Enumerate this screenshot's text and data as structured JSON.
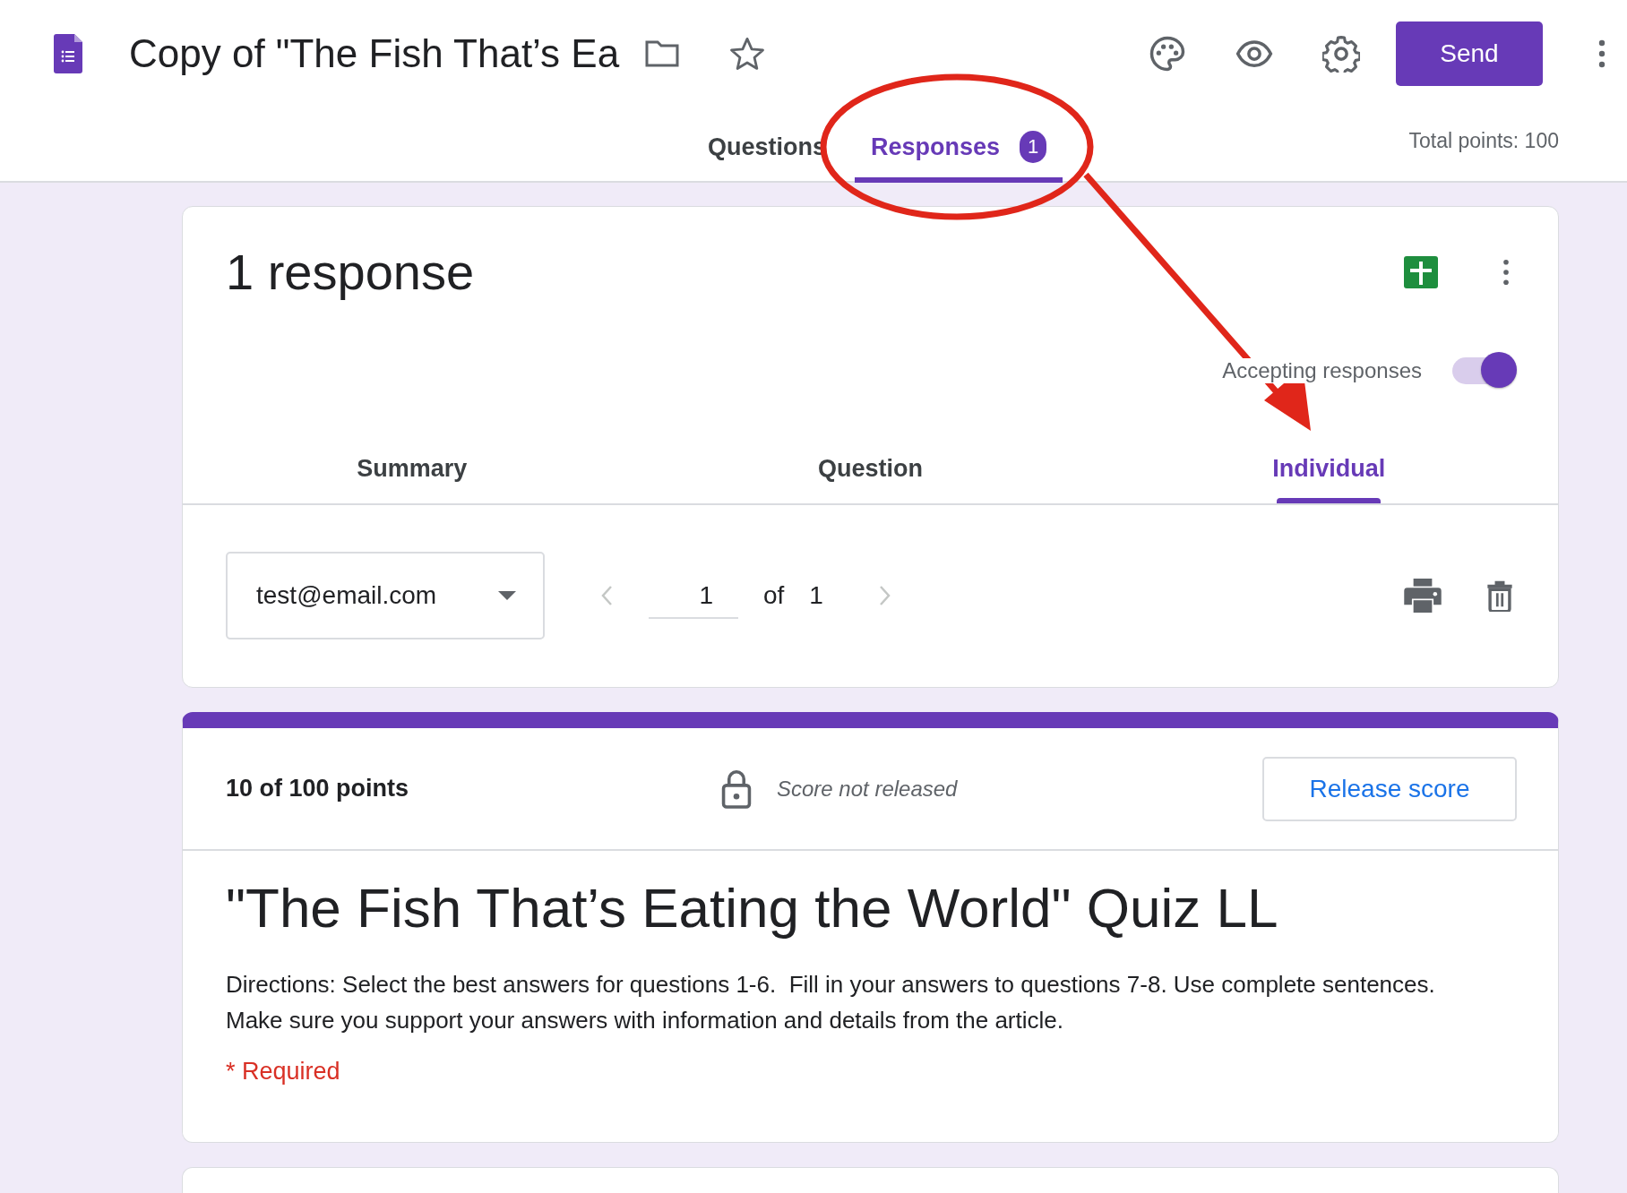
{
  "header": {
    "title": "Copy of \"The Fish That’s Ea",
    "send_label": "Send"
  },
  "tabs": [
    {
      "label": "Questions",
      "selected": false
    },
    {
      "label": "Responses",
      "selected": true,
      "badge": "1"
    }
  ],
  "total_points": "Total points: 100",
  "responses_card": {
    "title": "1 response",
    "accepting_label": "Accepting responses",
    "accepting_on": true,
    "views": [
      {
        "label": "Summary",
        "selected": false
      },
      {
        "label": "Question",
        "selected": false
      },
      {
        "label": "Individual",
        "selected": true
      }
    ],
    "respondent": "test@email.com",
    "page": "1",
    "of_label": "of",
    "page_total": "1"
  },
  "score_card": {
    "points": "10 of 100 points",
    "release_status": "Score not released",
    "release_button": "Release score",
    "quiz_title": "\"The Fish That’s Eating the World\" Quiz LL",
    "directions": "Directions: Select the best answers for questions 1-6.  Fill in your answers to questions 7-8. Use complete sentences. Make sure you support your answers with information and details from the article.",
    "required_note": "* Required"
  }
}
